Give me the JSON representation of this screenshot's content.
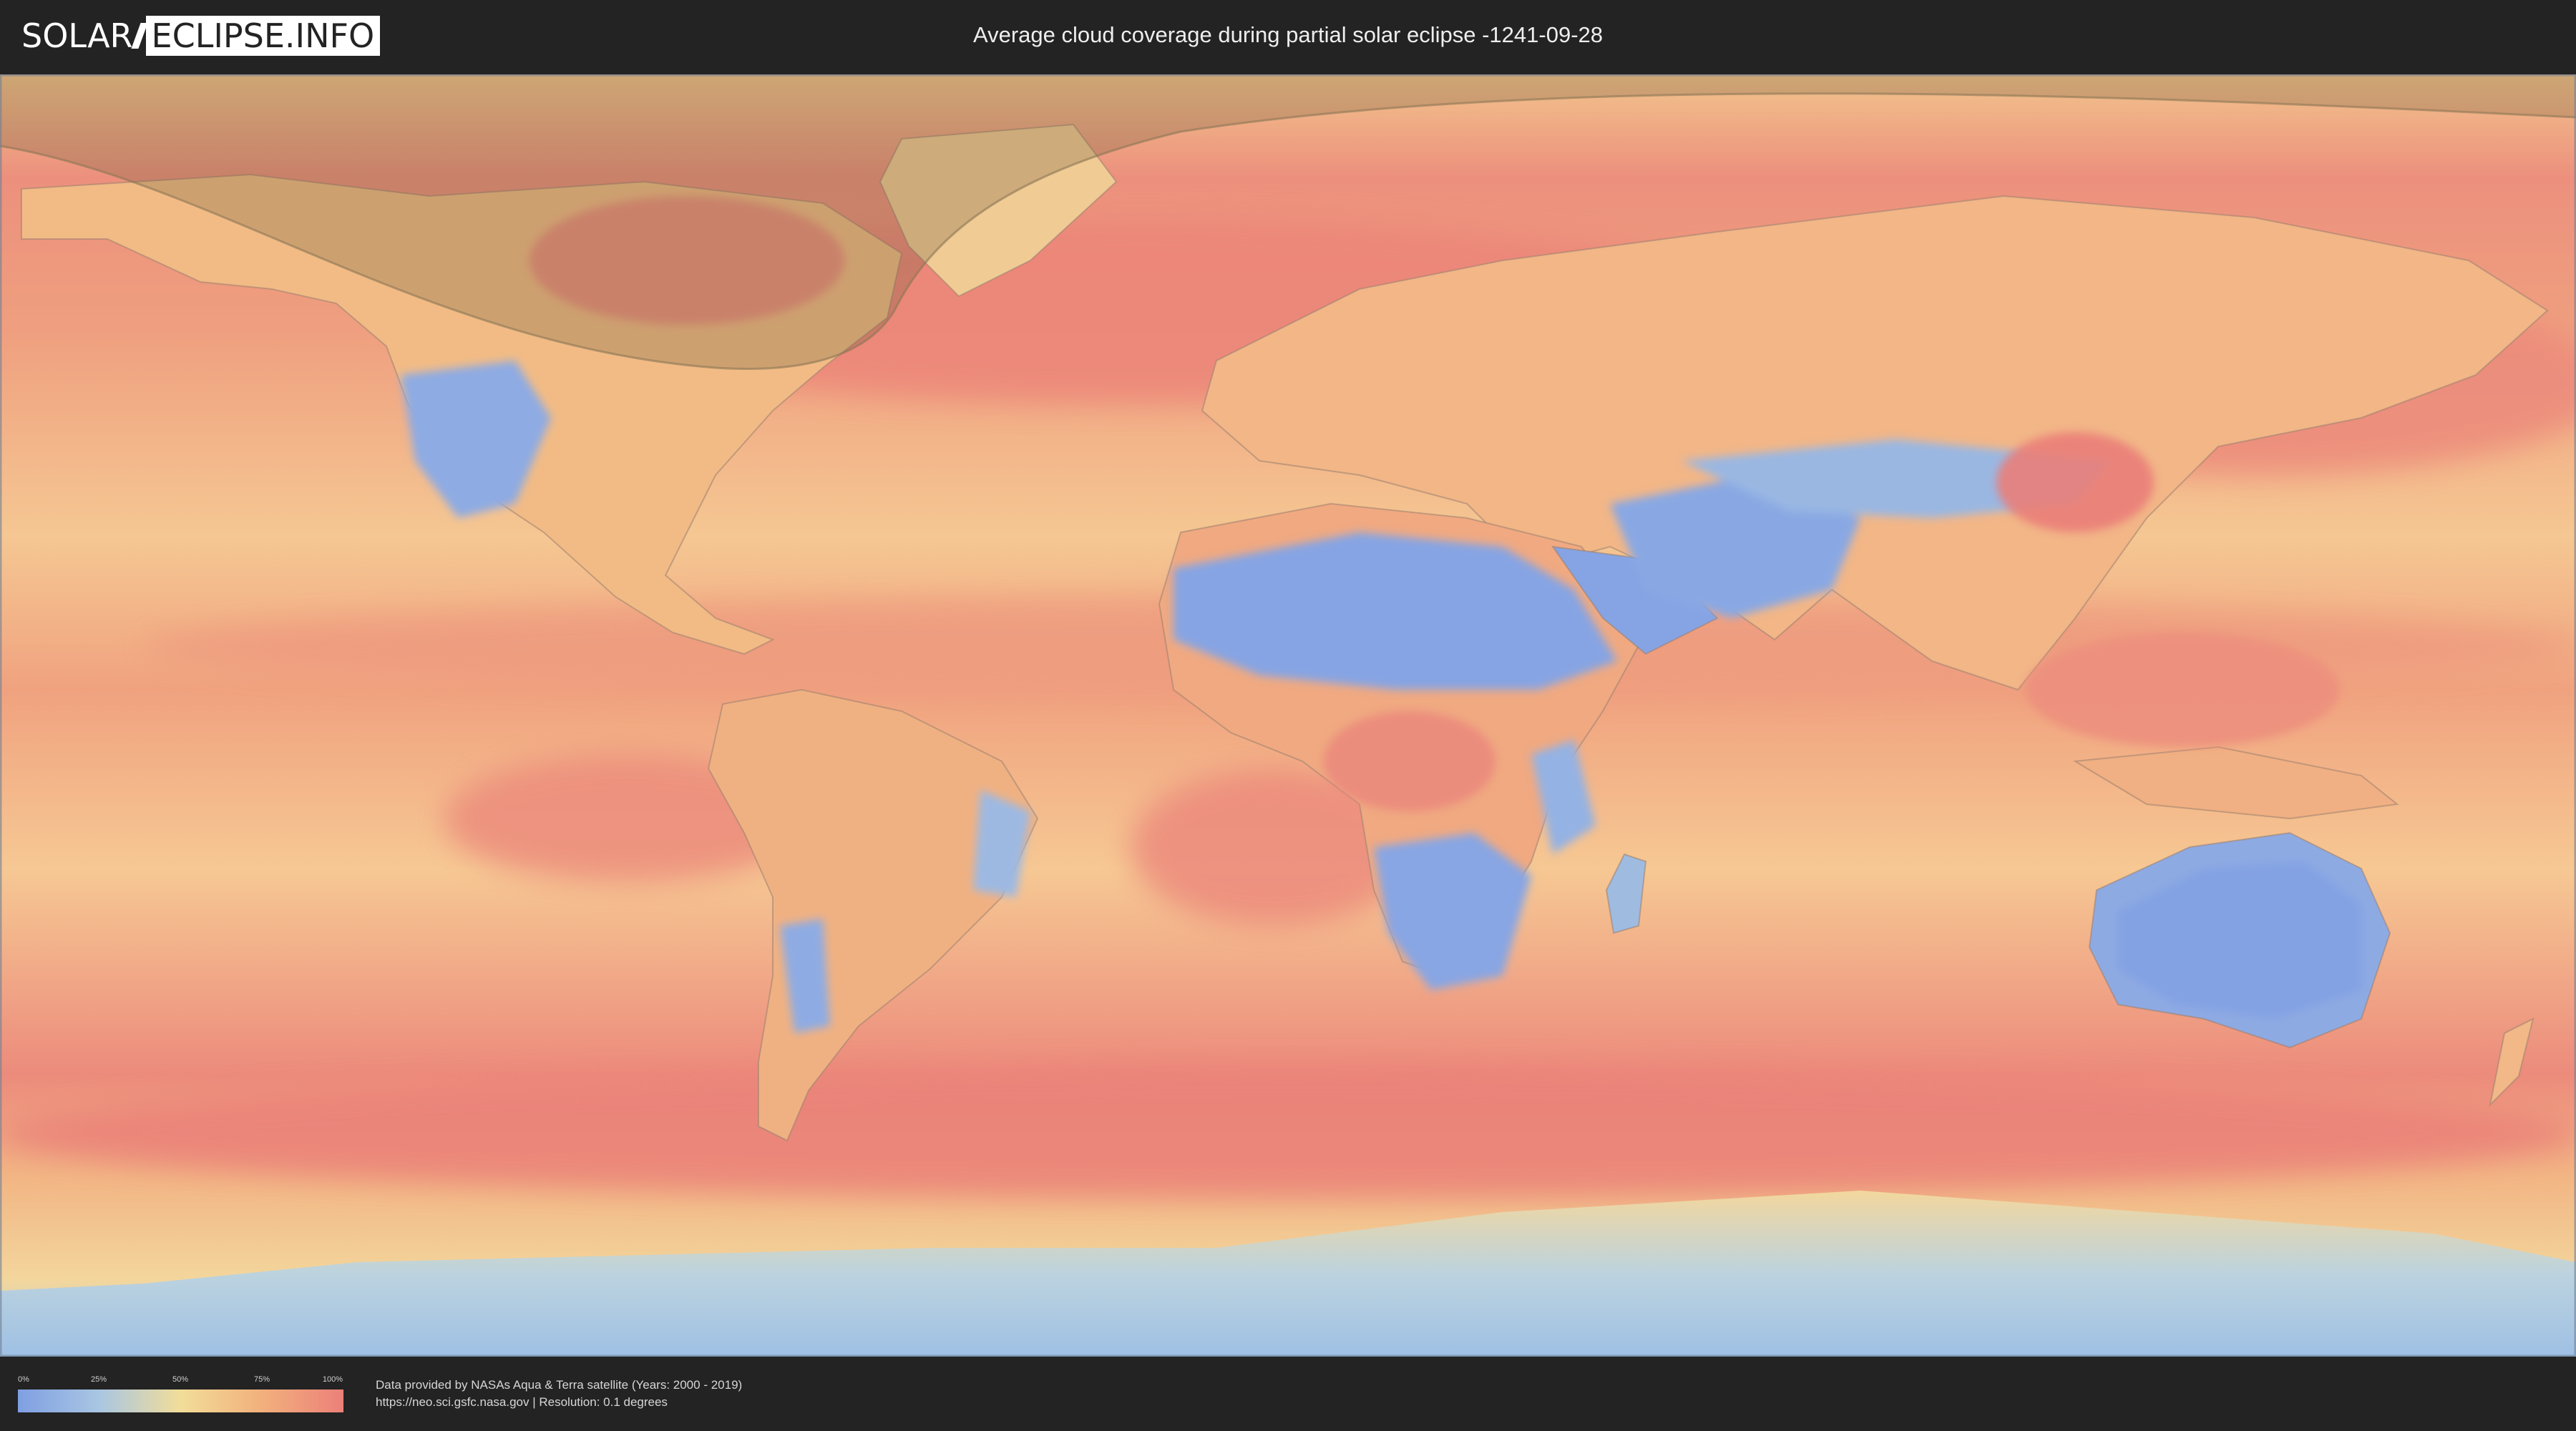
{
  "header": {
    "logo_part1": "SOLAR",
    "logo_part2": "ECLIPSE.INFO",
    "title": "Average cloud coverage during partial solar eclipse -1241-09-28"
  },
  "legend": {
    "ticks": [
      "0%",
      "25%",
      "50%",
      "75%",
      "100%"
    ],
    "colors": [
      "#7f9fe2",
      "#a9c6e2",
      "#f2dd99",
      "#f2b07c",
      "#ec8079"
    ]
  },
  "footer": {
    "credit_line1": "Data provided by NASAs Aqua & Terra satellite (Years: 2000 - 2019)",
    "credit_line2": "https://neo.sci.gsfc.nasa.gov | Resolution: 0.1 degrees"
  },
  "map": {
    "projection": "equirectangular",
    "ocean_color": "#f3b27f",
    "land_dry_color": "#86a6e3",
    "cloudy_color": "#ec8a7f",
    "eclipse_shadow_color": "#6e5a3a"
  }
}
